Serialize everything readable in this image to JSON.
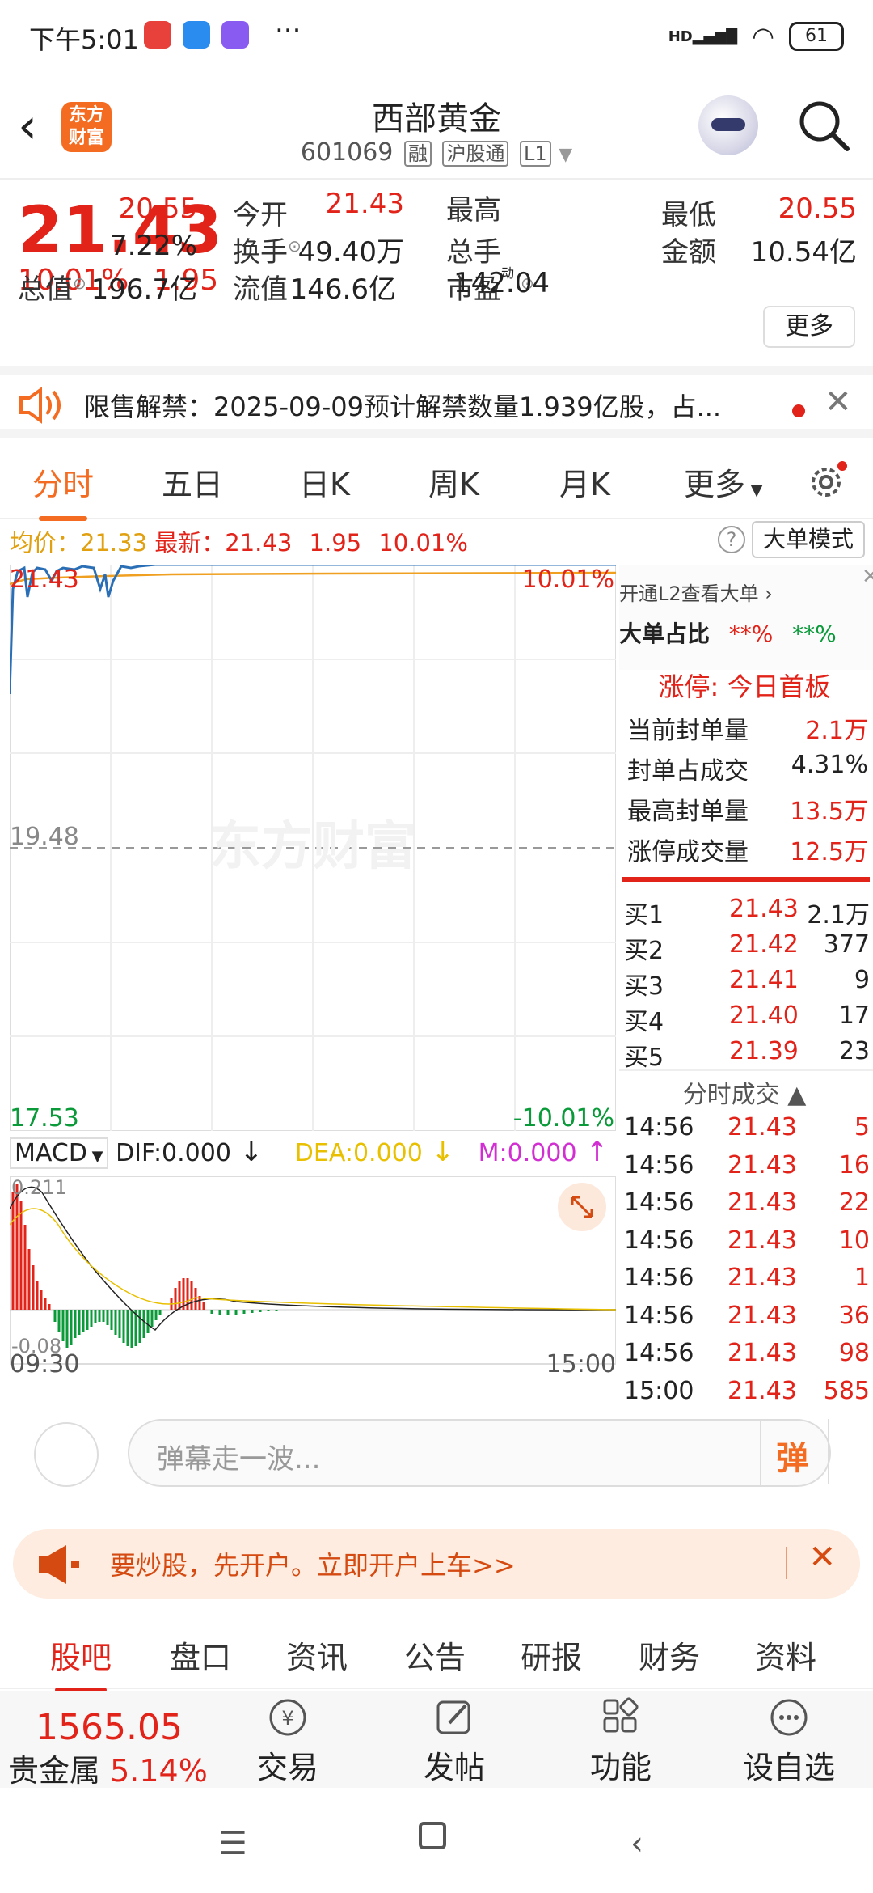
{
  "status": {
    "time": "下午5:01",
    "battery": "61",
    "signal": "HD"
  },
  "header": {
    "logo": "东方\n财富",
    "stock_name": "西部黄金",
    "code": "601069",
    "tags": [
      "融",
      "沪股通",
      "L1"
    ]
  },
  "quote": {
    "price": "21.43",
    "change_pct": "10.01%",
    "change": "1.95",
    "fields": [
      {
        "label": "今开",
        "value": "20.55",
        "color": "red"
      },
      {
        "label": "最高",
        "value": "21.43",
        "color": "red"
      },
      {
        "label": "最低",
        "value": "20.55",
        "color": "red"
      },
      {
        "label": "换手",
        "value": "7.22%",
        "color": "dark"
      },
      {
        "label": "总手",
        "value": "49.40万",
        "color": "dark"
      },
      {
        "label": "金额",
        "value": "10.54亿",
        "color": "dark"
      },
      {
        "label": "总值",
        "value": "196.7亿",
        "color": "dark"
      },
      {
        "label": "流值",
        "value": "146.6亿",
        "color": "dark"
      },
      {
        "label": "市盈",
        "value": "142.04",
        "color": "dark"
      }
    ],
    "more": "更多",
    "pe_sup": "动"
  },
  "notice": {
    "text": "限售解禁：2025-09-09预计解禁数量1.939亿股，占..."
  },
  "tabs": [
    "分时",
    "五日",
    "日K",
    "周K",
    "月K",
    "更多"
  ],
  "info": {
    "avg_label": "均价：",
    "avg": "21.33",
    "latest_label": "最新：",
    "latest": "21.43",
    "chg": "1.95",
    "pct": "10.01%",
    "big_order": "大单模式",
    "help": "?"
  },
  "chart": {
    "top_price": "21.43",
    "top_pct": "10.01%",
    "mid_price": "19.48",
    "bottom_price": "17.53",
    "bottom_pct": "-10.01%",
    "watermark": "东方财富",
    "start_time": "09:30",
    "end_time": "15:00"
  },
  "macd": {
    "name": "MACD",
    "dif": "DIF:0.000",
    "dea": "DEA:0.000",
    "m": "M:0.000",
    "max": "0.211",
    "min": "-0.08"
  },
  "right": {
    "l2": "开通L2查看大单",
    "big_ratio": "大单占比",
    "r1": "**%",
    "r2": "**%",
    "limit_up": "涨停: 今日首板",
    "rows": [
      {
        "label": "当前封单量",
        "value": "2.1万",
        "color": "red"
      },
      {
        "label": "封单占成交",
        "value": "4.31%",
        "color": "dark"
      },
      {
        "label": "最高封单量",
        "value": "13.5万",
        "color": "red"
      },
      {
        "label": "涨停成交量",
        "value": "12.5万",
        "color": "red"
      }
    ],
    "bids": [
      {
        "l": "买1",
        "p": "21.43",
        "n": "2.1万"
      },
      {
        "l": "买2",
        "p": "21.42",
        "n": "377"
      },
      {
        "l": "买3",
        "p": "21.41",
        "n": "9"
      },
      {
        "l": "买4",
        "p": "21.40",
        "n": "17"
      },
      {
        "l": "买5",
        "p": "21.39",
        "n": "23"
      }
    ],
    "ticks_title": "分时成交",
    "ticks": [
      {
        "t": "14:56",
        "p": "21.43",
        "n": "5"
      },
      {
        "t": "14:56",
        "p": "21.43",
        "n": "16"
      },
      {
        "t": "14:56",
        "p": "21.43",
        "n": "22"
      },
      {
        "t": "14:56",
        "p": "21.43",
        "n": "10"
      },
      {
        "t": "14:56",
        "p": "21.43",
        "n": "1"
      },
      {
        "t": "14:56",
        "p": "21.43",
        "n": "36"
      },
      {
        "t": "14:56",
        "p": "21.43",
        "n": "98"
      },
      {
        "t": "15:00",
        "p": "21.43",
        "n": "585"
      }
    ]
  },
  "danmu": {
    "placeholder": "弹幕走一波...",
    "button": "弹"
  },
  "ad": {
    "text": "要炒股，先开户。立即开户上车>>"
  },
  "bottom_tabs": [
    "股吧",
    "盘口",
    "资讯",
    "公告",
    "研报",
    "财务",
    "资料"
  ],
  "bottom": {
    "gold_price": "1565.05",
    "gold_name": "贵金属",
    "gold_pct": "5.14%",
    "actions": [
      "交易",
      "发帖",
      "功能",
      "设自选"
    ]
  },
  "colors": {
    "red": "#e2231a",
    "green": "#0a9a3a",
    "orange": "#f36c21",
    "avg_line": "#f0a020",
    "price_line": "#2a6fb6"
  }
}
